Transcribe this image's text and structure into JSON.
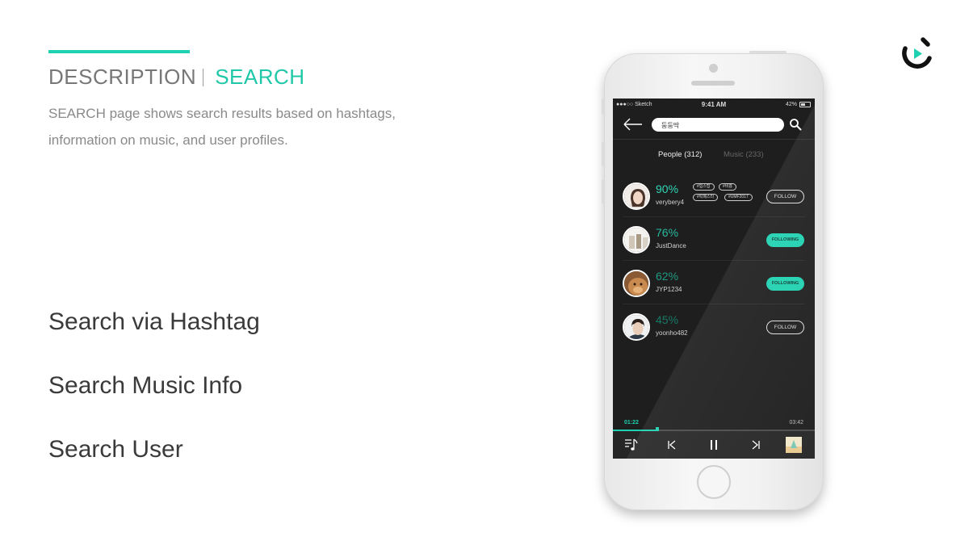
{
  "slide": {
    "title_prefix": "DESCRIPTION",
    "title_main": "SEARCH",
    "description": "SEARCH page shows search results based on hashtags, information on music, and user profiles.",
    "features": [
      "Search via Hashtag",
      "Search Music Info",
      "Search User"
    ],
    "accent_color": "#1fd1b0"
  },
  "status_bar": {
    "carrier": "●●●○○ Sketch",
    "time": "9:41 AM",
    "battery": "42%"
  },
  "search": {
    "query": "둠둠딱",
    "back_icon": "arrow-left-icon",
    "search_icon": "magnifier-icon"
  },
  "tabs": [
    {
      "label": "People (312)",
      "active": true
    },
    {
      "label": "Music (233)",
      "active": false
    }
  ],
  "results": [
    {
      "percent": "90%",
      "username": "verybery4",
      "tags": [
        "#힙스탑",
        "#비흡",
        "#락페스타",
        "#UMF2017"
      ],
      "button": "FOLLOW",
      "following": false,
      "percent_color": "#2fd6b6"
    },
    {
      "percent": "76%",
      "username": "JustDance",
      "tags": [],
      "button": "FOLLOWING",
      "following": true,
      "percent_color": "#27b99d"
    },
    {
      "percent": "62%",
      "username": "JYP1234",
      "tags": [],
      "button": "FOLLOWING",
      "following": true,
      "percent_color": "#1f9a83"
    },
    {
      "percent": "45%",
      "username": "yoonho482",
      "tags": [],
      "button": "FOLLOW",
      "following": false,
      "percent_color": "#177a68"
    }
  ],
  "player": {
    "current_time": "01:22",
    "total_time": "03:42",
    "progress": 0.22
  }
}
